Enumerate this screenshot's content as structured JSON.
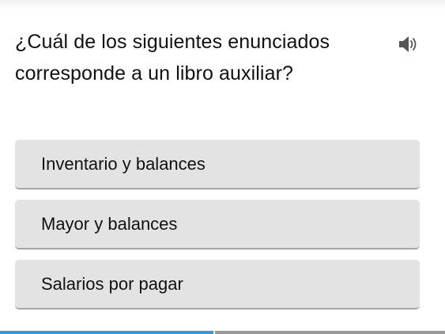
{
  "question": {
    "text": "¿Cuál de los siguientes enunciados corresponde a un libro auxiliar?",
    "speaker_icon": "speaker-volume-icon"
  },
  "options": [
    {
      "label": "Inventario y balances"
    },
    {
      "label": "Mayor y balances"
    },
    {
      "label": "Salarios por pagar"
    }
  ],
  "progress": {
    "fraction": 0.48,
    "fill_color": "#2b9ee3",
    "track_color": "#9a9a9a"
  },
  "colors": {
    "option_background": "#e3e3e3",
    "option_border": "#a6a6a6",
    "text": "#111111"
  }
}
